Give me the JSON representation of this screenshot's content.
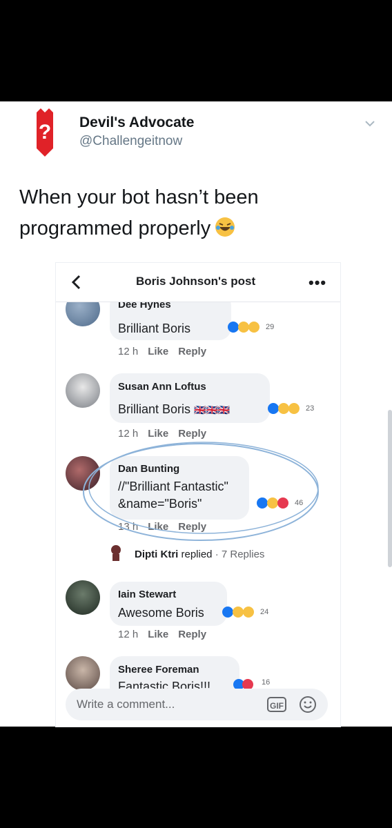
{
  "tweet": {
    "author": "Devil's Advocate",
    "handle": "@Challengeitnow",
    "text": "When your bot hasn’t been programmed properly",
    "logo_color": "#e02228"
  },
  "post": {
    "title": "Boris Johnson's post",
    "more": "•••",
    "comments": [
      {
        "name": "Dee Hynes",
        "text": "Brilliant Boris",
        "reactions": "29",
        "time": "12 h",
        "like": "Like",
        "reply": "Reply"
      },
      {
        "name": "Susan Ann Loftus",
        "text": "Brilliant Boris",
        "flags": "🇬🇧🇬🇧🇬🇧",
        "reactions": "23",
        "time": "12 h",
        "like": "Like",
        "reply": "Reply"
      },
      {
        "name": "Dan Bunting",
        "text_line1": "//\"Brilliant Fantastic\"",
        "text_line2": "&name=\"Boris\"",
        "reactions": "46",
        "time": "13 h",
        "like": "Like",
        "reply": "Reply"
      },
      {
        "name": "Iain Stewart",
        "text": "Awesome Boris",
        "reactions": "24",
        "time": "12 h",
        "like": "Like",
        "reply": "Reply"
      },
      {
        "name": "Sheree Foreman",
        "text": "Fantastic Boris!!!",
        "reactions": "16"
      }
    ],
    "replied": {
      "name": "Dipti Ktri",
      "action": "replied",
      "sep": " · ",
      "count": "7 Replies"
    },
    "composer_placeholder": "Write a comment...",
    "gif_label": "GIF"
  },
  "colors": {
    "like_blue": "#1877f2",
    "laugh_yellow": "#f7c143",
    "love_red": "#e63950",
    "circle_blue": "#8db3d9"
  }
}
